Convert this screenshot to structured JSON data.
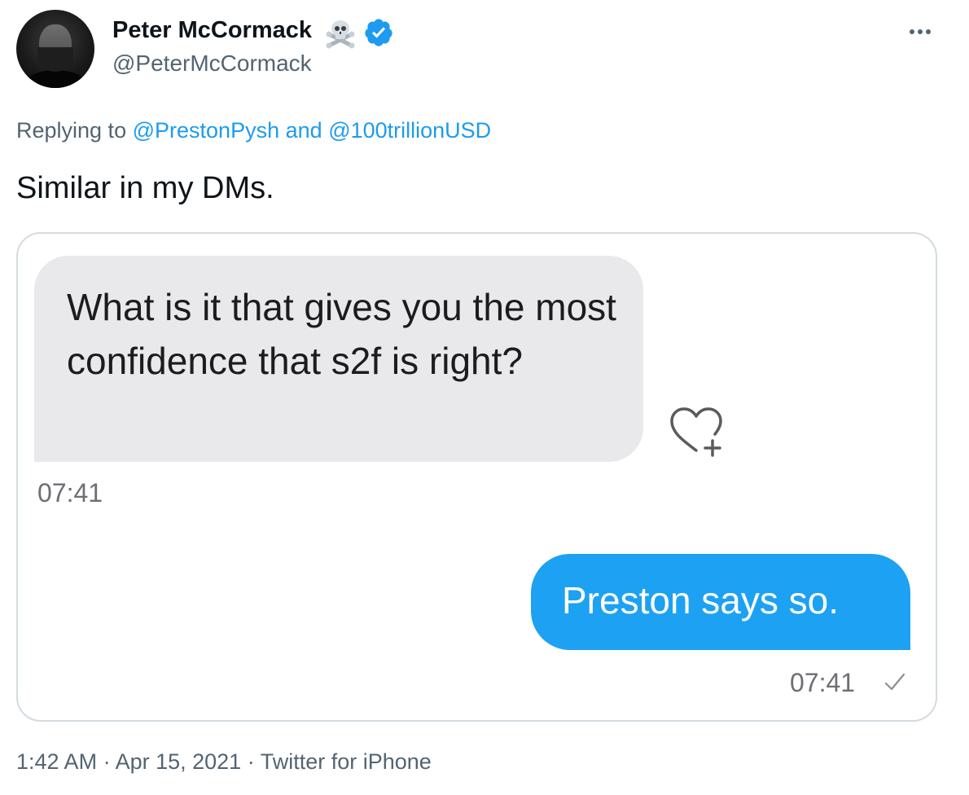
{
  "tweet": {
    "author": {
      "display_name": "Peter McCormack",
      "handle": "@PeterMcCormack",
      "name_emoji_icon": "skull-and-crossbones-icon",
      "verified_icon": "verified-badge-icon"
    },
    "more_icon": "more-horizontal-icon",
    "replying": {
      "prefix": "Replying to",
      "mention_1": "@PrestonPysh",
      "conjunction": "and",
      "mention_2": "@100trillionUSD"
    },
    "text": "Similar in my DMs.",
    "media": {
      "received_message": "What is it that gives you the most confidence that s2f is right?",
      "received_time": "07:41",
      "react_icon": "heart-plus-icon",
      "sent_message": "Preston says so.",
      "sent_time": "07:41",
      "sent_status_icon": "checkmark-icon"
    },
    "meta": {
      "time": "1:42 AM",
      "separator": " · ",
      "date": "Apr 15, 2021",
      "source": "Twitter for iPhone"
    }
  },
  "colors": {
    "link": "#1d9bf0",
    "secondary_text": "#536471",
    "sent_bubble": "#1da1f2",
    "received_bubble": "#e9e9eb",
    "verified": "#1d9bf0"
  }
}
